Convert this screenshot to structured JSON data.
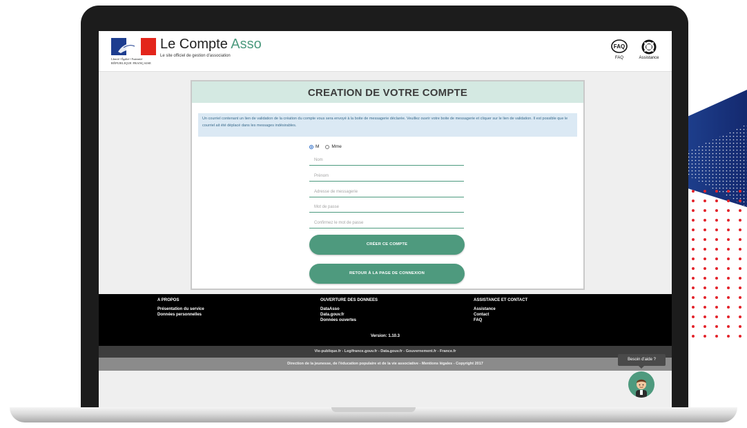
{
  "header": {
    "logo": {
      "motto": "Liberté • Égalité • Fraternité",
      "republique": "RÉPUBLIQUE FRANÇAISE",
      "flag_colors": [
        "#1d3d8f",
        "#ffffff",
        "#e3251b"
      ]
    },
    "title_main": "Le Compte",
    "title_accent": "Asso",
    "subtitle": "Le site officiel de gestion d'association",
    "faq_label": "FAQ",
    "faq_icon_text": "FAQ",
    "assistance_label": "Assistance"
  },
  "form": {
    "title": "CREATION DE VOTRE COMPTE",
    "info": "Un courriel contenant un lien de validation de la création du compte vous sera envoyé à la boite de messagerie déclarée. Veuillez ouvrir votre boite de messagerie et cliquer sur le lien de validation. Il est possible que le courriel ait été déplacé dans les messages indésirables.",
    "civility": {
      "options": [
        "M",
        "Mme"
      ],
      "selected": "M"
    },
    "fields": {
      "nom": {
        "placeholder": "Nom",
        "value": ""
      },
      "prenom": {
        "placeholder": "Prénom",
        "value": ""
      },
      "email": {
        "placeholder": "Adresse de messagerie",
        "value": ""
      },
      "password": {
        "placeholder": "Mot de passe",
        "value": ""
      },
      "password_confirm": {
        "placeholder": "Confirmez le mot de passe",
        "value": ""
      }
    },
    "create_button": "CRÉER CE COMPTE",
    "back_button": "RETOUR À LA PAGE DE CONNEXION"
  },
  "footer": {
    "apropos": {
      "heading": "A PROPOS",
      "links": [
        "Présentation du service",
        "Données personnelles"
      ]
    },
    "ouverture": {
      "heading": "OUVERTURE DES DONNEES",
      "links": [
        "DataAsso",
        "Data.gouv.fr",
        "Données ouvertes"
      ]
    },
    "assistance": {
      "heading": "ASSISTANCE ET CONTACT",
      "links": [
        "Assistance",
        "Contact",
        "FAQ"
      ]
    },
    "version": "Version: 1.10.3",
    "partner_links": "Vie-publique.fr - Legifrance.gouv.fr - Data.gouv.fr - Gouvernement.fr - France.fr",
    "copyright": "Direction de la jeunesse, de l'éducation populaire et de la vie associative - Mentions légales - Copyright 2017"
  },
  "help": {
    "bubble": "Besoin d'aide ?"
  },
  "colors": {
    "accent_green": "#4e9a7e",
    "header_band": "#d4e9e2",
    "info_band": "#dbe9f4",
    "deco_red": "#e3242b",
    "deco_blue": "#1b3a8c"
  }
}
